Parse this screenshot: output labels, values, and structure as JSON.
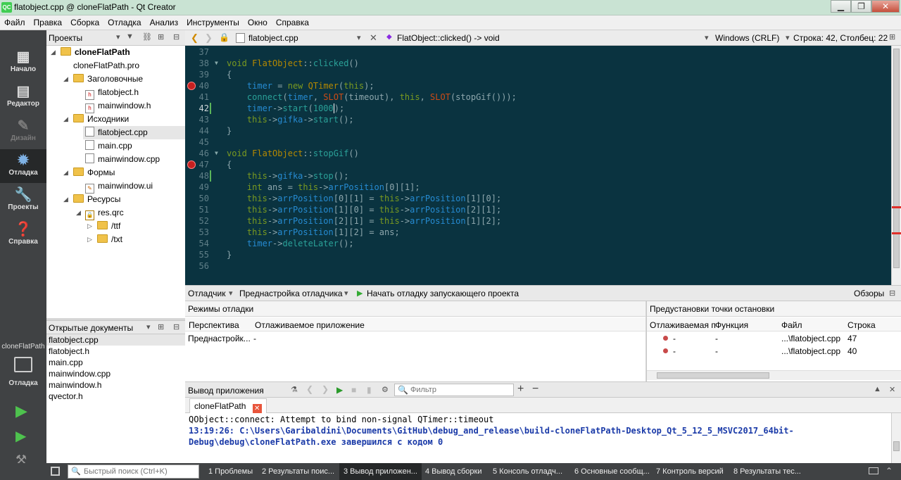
{
  "window": {
    "title": "flatobject.cpp @ cloneFlatPath - Qt Creator",
    "app_icon": "QC"
  },
  "menu": [
    "Файл",
    "Правка",
    "Сборка",
    "Отладка",
    "Анализ",
    "Инструменты",
    "Окно",
    "Справка"
  ],
  "modes": {
    "welcome": "Начало",
    "edit": "Редактор",
    "design": "Дизайн",
    "debug": "Отладка",
    "projects": "Проекты",
    "help": "Справка",
    "kit_project": "cloneFlatPath",
    "kit_mode": "Отладка"
  },
  "navigator": {
    "title": "Проекты"
  },
  "tree": [
    {
      "label": "cloneFlatPath"
    },
    {
      "label": "cloneFlatPath.pro"
    },
    {
      "label": "Заголовочные"
    },
    {
      "label": "flatobject.h"
    },
    {
      "label": "mainwindow.h"
    },
    {
      "label": "Исходники"
    },
    {
      "label": "flatobject.cpp"
    },
    {
      "label": "main.cpp"
    },
    {
      "label": "mainwindow.cpp"
    },
    {
      "label": "Формы"
    },
    {
      "label": "mainwindow.ui"
    },
    {
      "label": "Ресурсы"
    },
    {
      "label": "res.qrc"
    },
    {
      "label": "/ttf"
    },
    {
      "label": "/txt"
    }
  ],
  "open_docs": {
    "title": "Открытые документы",
    "items": [
      "flatobject.cpp",
      "flatobject.h",
      "main.cpp",
      "mainwindow.cpp",
      "mainwindow.h",
      "qvector.h"
    ]
  },
  "editor_toolbar": {
    "file": "flatobject.cpp",
    "symbol": "FlatObject::clicked() -> void",
    "encoding": "Windows (CRLF)",
    "position": "Строка: 42, Столбец: 22"
  },
  "code": {
    "numbers": [
      "37",
      "38",
      "39",
      "40",
      "41",
      "42",
      "43",
      "44",
      "45",
      "46",
      "47",
      "48",
      "49",
      "50",
      "51",
      "52",
      "53",
      "54",
      "55",
      "56"
    ],
    "current_line": "42"
  },
  "debug_bar": {
    "debugger": "Отладчик",
    "preset": "Преднастройка отладчика",
    "start": "Начать отладку запускающего проекта",
    "views": "Обзоры"
  },
  "debug_modes": {
    "title": "Режимы отладки",
    "col1": "Перспектива",
    "col2": "Отлаживаемое приложение",
    "row_c1": "Преднастройк...",
    "row_c2": "-"
  },
  "breakpoints": {
    "title": "Предустановки точки остановки",
    "cols": [
      "Отлаживаемая п",
      "Функция",
      "Файл",
      "Строка"
    ],
    "rows": [
      {
        "app": "-",
        "func": "-",
        "file": "...\\flatobject.cpp",
        "line": "47"
      },
      {
        "app": "-",
        "func": "-",
        "file": "...\\flatobject.cpp",
        "line": "40"
      }
    ]
  },
  "output": {
    "title": "Вывод приложения",
    "filter_placeholder": "Фильтр",
    "tab": "cloneFlatPath",
    "line1": "QObject::connect: Attempt to bind non-signal QTimer::timeout",
    "line2": "13:19:26: C:\\Users\\Garibaldini\\Documents\\GitHub\\debug_and_release\\build-cloneFlatPath-Desktop_Qt_5_12_5_MSVC2017_64bit-",
    "line3": "Debug\\debug\\cloneFlatPath.exe завершился с кодом 0"
  },
  "statusbar": {
    "search_placeholder": "Быстрый поиск (Ctrl+K)",
    "tabs": [
      "1 Проблемы",
      "2 Результаты поис...",
      "3 Вывод приложен...",
      "4 Вывод сборки",
      "5 Консоль отладч...",
      "6 Основные сообщ...",
      "7 Контроль версий",
      "8 Результаты тес..."
    ]
  }
}
